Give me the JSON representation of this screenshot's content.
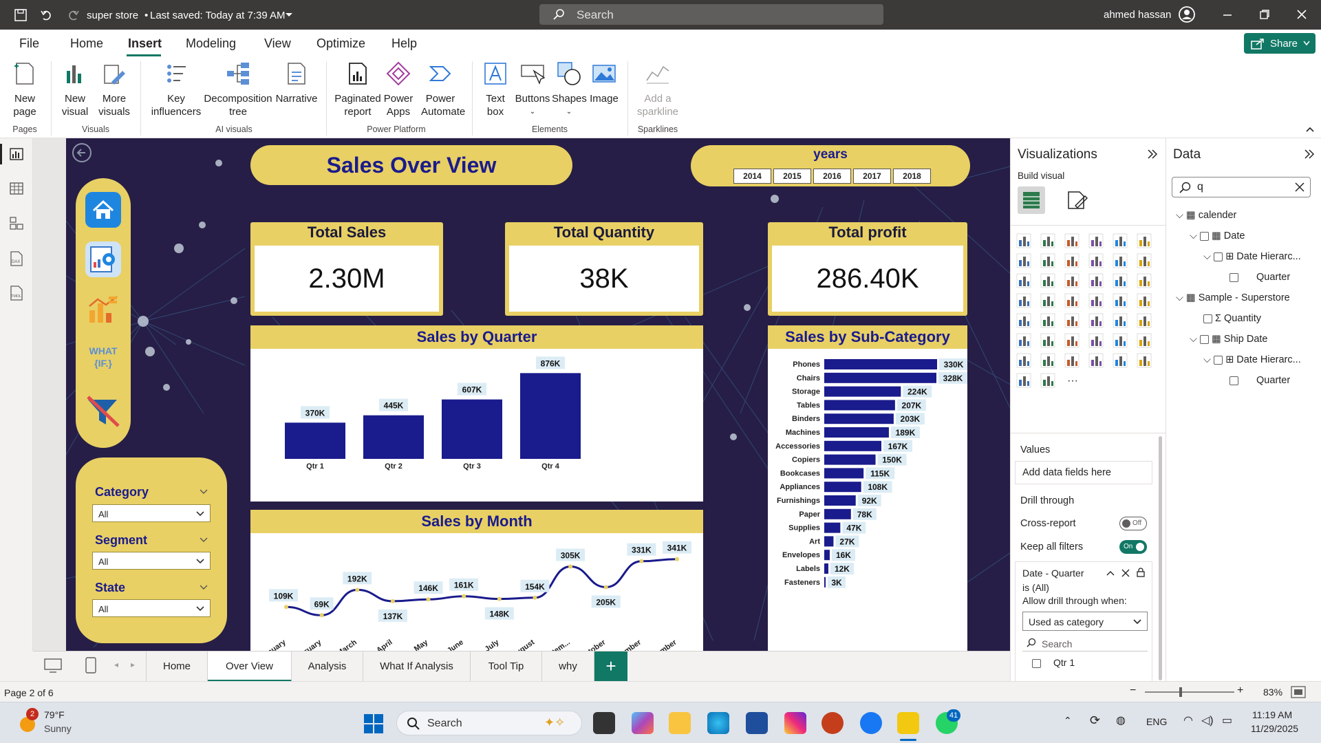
{
  "titlebar": {
    "doc_title": "super store",
    "saved_status": "Last saved: Today at 7:39 AM",
    "search_placeholder": "Search",
    "user_name": "ahmed hassan"
  },
  "ribbon_tabs": [
    "File",
    "Home",
    "Insert",
    "Modeling",
    "View",
    "Optimize",
    "Help"
  ],
  "share_label": "Share",
  "ribbon": {
    "new_page": "New page",
    "new_visual": "New visual",
    "more_visuals": "More visuals",
    "key_influencers": "Key influencers",
    "decomposition_tree": "Decomposition tree",
    "narrative": "Narrative",
    "paginated_report": "Paginated report",
    "power_apps": "Power Apps",
    "power_automate": "Power Automate",
    "text_box": "Text box",
    "buttons": "Buttons",
    "shapes": "Shapes",
    "image": "Image",
    "add_sparkline": "Add a sparkline",
    "groups": {
      "pages": "Pages",
      "visuals": "Visuals",
      "ai_visuals": "AI visuals",
      "power_platform": "Power Platform",
      "elements": "Elements",
      "sparklines": "Sparklines"
    }
  },
  "report": {
    "title": "Sales Over View",
    "years_label": "years",
    "years": [
      "2014",
      "2015",
      "2016",
      "2017",
      "2018"
    ],
    "kpis": [
      {
        "label": "Total Sales",
        "value": "2.30M"
      },
      {
        "label": "Total Quantity",
        "value": "38K"
      },
      {
        "label": "Total profit",
        "value": "286.40K"
      }
    ],
    "slicers": {
      "category_label": "Category",
      "category_value": "All",
      "segment_label": "Segment",
      "segment_value": "All",
      "state_label": "State",
      "state_value": "All"
    },
    "nav_icons": [
      "home-icon",
      "analysis-icon",
      "charts-icon",
      "what-if-icon",
      "tooltip-icon"
    ],
    "whatif_text": "WHAT {IF.}"
  },
  "chart_data": [
    {
      "type": "bar",
      "title": "Sales by Quarter",
      "categories": [
        "Qtr 1",
        "Qtr 2",
        "Qtr 3",
        "Qtr 4"
      ],
      "values": [
        370,
        445,
        607,
        876
      ],
      "labels": [
        "370K",
        "445K",
        "607K",
        "876K"
      ],
      "ylim": [
        0,
        950
      ],
      "color": "#1a1b8c"
    },
    {
      "type": "line",
      "title": "Sales by Month",
      "categories": [
        "January",
        "February",
        "March",
        "April",
        "May",
        "June",
        "July",
        "August",
        "Septem...",
        "October",
        "November",
        "December"
      ],
      "values": [
        109,
        69,
        192,
        137,
        146,
        161,
        148,
        154,
        305,
        205,
        331,
        341
      ],
      "labels": [
        "109K",
        "69K",
        "192K",
        "137K",
        "146K",
        "161K",
        "148K",
        "154K",
        "305K",
        "205K",
        "331K",
        "341K"
      ],
      "ylim": [
        0,
        400
      ],
      "color": "#1a1b8c"
    },
    {
      "type": "bar",
      "orientation": "horizontal",
      "title": "Sales by Sub-Category",
      "categories": [
        "Phones",
        "Chairs",
        "Storage",
        "Tables",
        "Binders",
        "Machines",
        "Accessories",
        "Copiers",
        "Bookcases",
        "Appliances",
        "Furnishings",
        "Paper",
        "Supplies",
        "Art",
        "Envelopes",
        "Labels",
        "Fasteners"
      ],
      "values": [
        330,
        328,
        224,
        207,
        203,
        189,
        167,
        150,
        115,
        108,
        92,
        78,
        47,
        27,
        16,
        12,
        3
      ],
      "labels": [
        "330K",
        "328K",
        "224K",
        "207K",
        "203K",
        "189K",
        "167K",
        "150K",
        "115K",
        "108K",
        "92K",
        "78K",
        "47K",
        "27K",
        "16K",
        "12K",
        "3K"
      ],
      "xlim": [
        0,
        330
      ],
      "color": "#1a1b8c"
    }
  ],
  "viz_pane": {
    "title": "Visualizations",
    "build_visual": "Build visual",
    "values_label": "Values",
    "add_fields": "Add data fields here",
    "drill_through": "Drill through",
    "cross_report": "Cross-report",
    "cross_report_state": "Off",
    "keep_filters": "Keep all filters",
    "keep_filters_state": "On",
    "filter_name": "Date - Quarter",
    "filter_is": "is (All)",
    "allow_drill": "Allow drill through when:",
    "used_as": "Used as category",
    "search_placeholder": "Search",
    "qtr1": "Qtr 1"
  },
  "data_pane": {
    "title": "Data",
    "search_value": "q",
    "tree": [
      "calender",
      "Date",
      "Date Hierarc...",
      "Quarter",
      "Sample - Superstore",
      "Quantity",
      "Ship Date",
      "Date Hierarc...",
      "Quarter"
    ]
  },
  "page_tabs": [
    "Home",
    "Over View",
    "Analysis",
    "What If Analysis",
    "Tool Tip",
    "why"
  ],
  "status": {
    "page": "Page 2 of 6",
    "zoom": "83%"
  },
  "taskbar": {
    "weather_temp": "79°F",
    "weather_desc": "Sunny",
    "weather_badge": "2",
    "search": "Search",
    "lang": "ENG",
    "time": "11:19 AM",
    "date": "11/29/2025",
    "whatsapp_badge": "41"
  },
  "colors": {
    "report_bg": "#261e46",
    "accent_yellow": "#e8d064",
    "bar_blue": "#1a1b8c",
    "ribbon_green": "#117865"
  }
}
